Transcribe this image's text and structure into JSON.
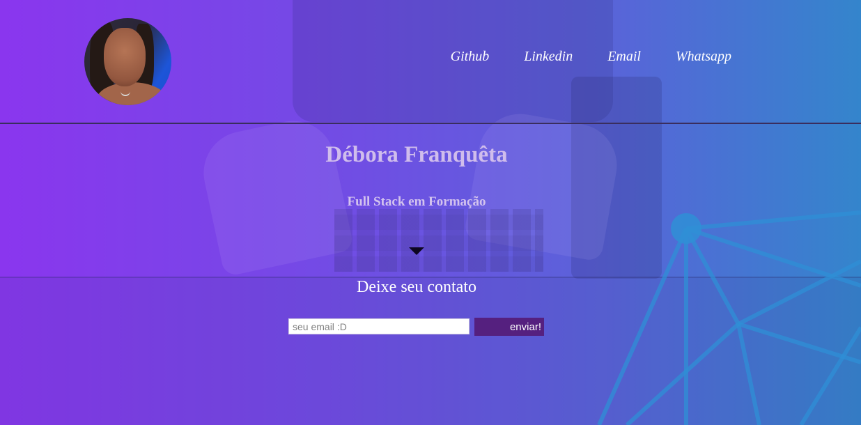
{
  "header": {
    "avatar_alt": "profile photo",
    "nav": [
      {
        "label": "Github"
      },
      {
        "label": "Linkedin"
      },
      {
        "label": "Email"
      },
      {
        "label": "Whatsapp"
      }
    ]
  },
  "hero": {
    "title": "Débora Franquêta",
    "subtitle": "Full Stack em Formação",
    "arrow_icon": "triangle-down-icon"
  },
  "contact": {
    "title": "Deixe seu contato",
    "email_placeholder": "seu email :D",
    "email_value": "",
    "submit_label": "enviar!"
  },
  "colors": {
    "gradient_start": "#8a36ee",
    "gradient_end": "#3485cc",
    "button": "#55207f",
    "title_text": "#d0bdec"
  }
}
